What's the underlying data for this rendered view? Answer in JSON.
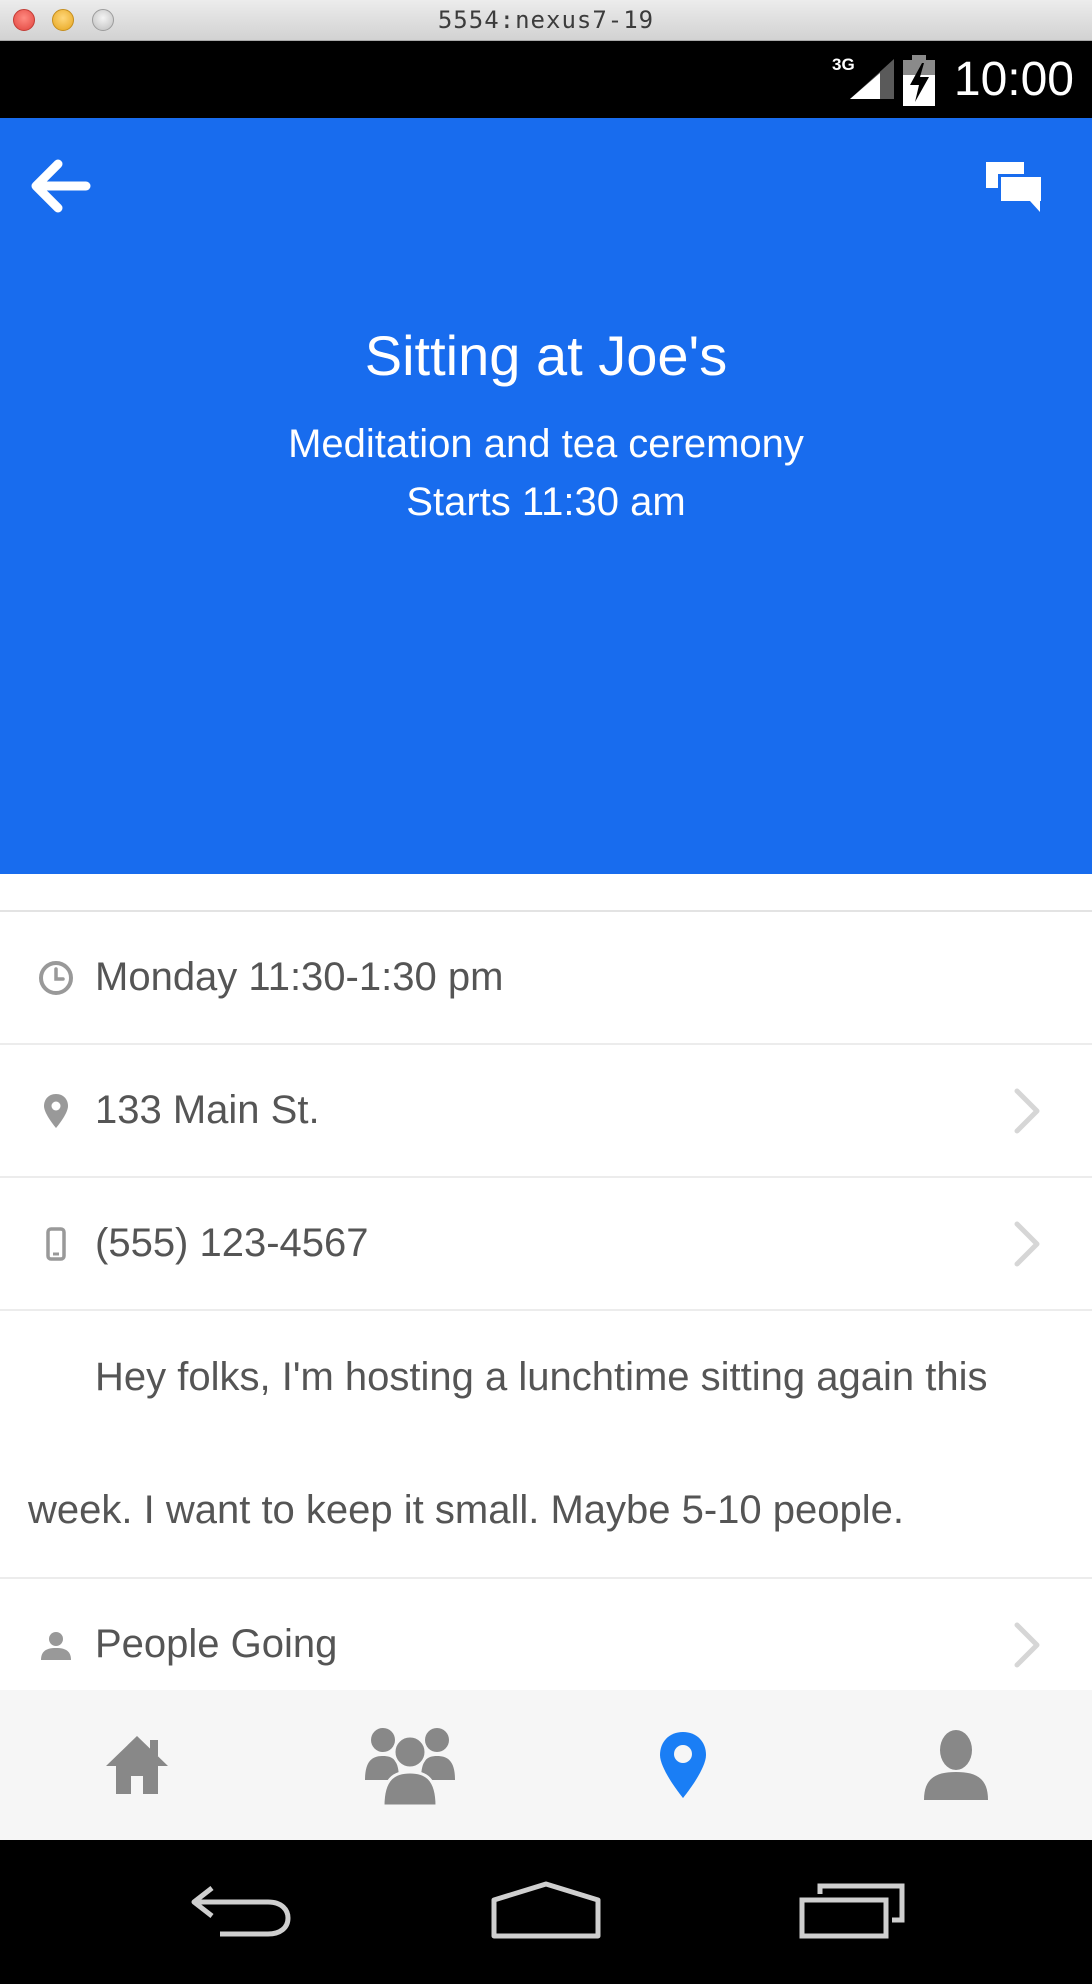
{
  "window": {
    "title": "5554:nexus7-19"
  },
  "statusbar": {
    "network": "3G",
    "time": "10:00"
  },
  "event": {
    "title": "Sitting at Joe's",
    "subtitle": "Meditation and tea ceremony",
    "start": "Starts 11:30 am"
  },
  "details": {
    "time": "Monday 11:30-1:30 pm",
    "address": "133 Main St.",
    "phone": "(555) 123-4567",
    "description": "Hey folks, I'm hosting a lunchtime sitting again this week. I want to keep it small. Maybe 5-10 people.",
    "people": "People Going"
  },
  "colors": {
    "accent": "#186cee",
    "nav_active": "#1a7ef5",
    "icon_gray": "#888888",
    "chevron": "#d6d6d6"
  },
  "bottomnav": {
    "items": [
      {
        "icon": "home-icon",
        "active": false
      },
      {
        "icon": "group-icon",
        "active": false
      },
      {
        "icon": "location-pin-icon",
        "active": true
      },
      {
        "icon": "user-icon",
        "active": false
      }
    ]
  }
}
